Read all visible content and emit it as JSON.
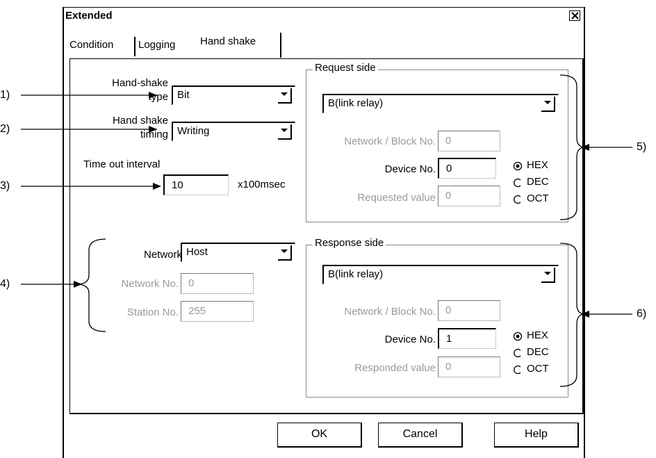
{
  "dialog": {
    "title": "Extended"
  },
  "tabs": [
    {
      "label": "Condition"
    },
    {
      "label": "Logging"
    },
    {
      "label": "Hand shake",
      "active": true
    }
  ],
  "handshake": {
    "type_label_1": "Hand-shake",
    "type_label_2": "type",
    "type_value": "Bit",
    "timing_label_1": "Hand shake",
    "timing_label_2": "timing",
    "timing_value": "Writing",
    "timeout_label": "Time out interval",
    "timeout_value": "10",
    "timeout_unit": "x100msec"
  },
  "network": {
    "network_label": "Network",
    "network_value": "Host",
    "network_no_label": "Network No.",
    "network_no_value": "0",
    "station_no_label": "Station No.",
    "station_no_value": "255"
  },
  "request": {
    "title": "Request side",
    "device_type": "B(link relay)",
    "network_block_label": "Network / Block No.",
    "network_block_value": "0",
    "device_no_label": "Device No.",
    "device_no_value": "0",
    "value_label": "Requested value",
    "value_value": "0",
    "radios": [
      "HEX",
      "DEC",
      "OCT"
    ],
    "selected_radio": "HEX"
  },
  "response": {
    "title": "Response side",
    "device_type": "B(link relay)",
    "network_block_label": "Network / Block No.",
    "network_block_value": "0",
    "device_no_label": "Device No.",
    "device_no_value": "1",
    "value_label": "Responded value",
    "value_value": "0",
    "radios": [
      "HEX",
      "DEC",
      "OCT"
    ],
    "selected_radio": "HEX"
  },
  "buttons": {
    "ok": "OK",
    "cancel": "Cancel",
    "help": "Help"
  },
  "callouts": [
    "1)",
    "2)",
    "3)",
    "4)",
    "5)",
    "6)"
  ],
  "colors": {
    "disabled_text": "#9a9a9a",
    "border": "#000000"
  }
}
